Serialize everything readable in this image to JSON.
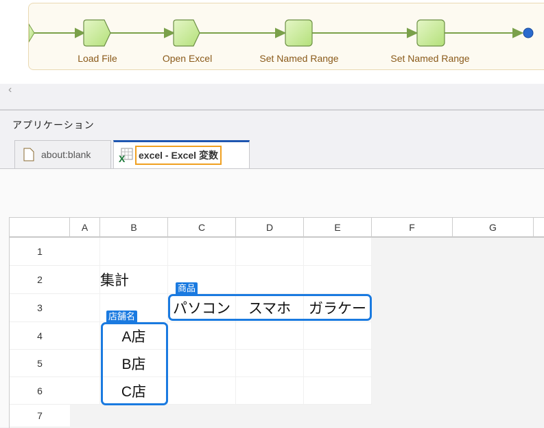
{
  "workflow": {
    "nodes": [
      "Load File",
      "Open Excel",
      "Set Named Range",
      "Set Named Range"
    ]
  },
  "panel": {
    "title": "アプリケーション"
  },
  "tabs": [
    {
      "label": "about:blank"
    },
    {
      "label": "excel - Excel 変数"
    }
  ],
  "sheet": {
    "columns": [
      "A",
      "B",
      "C",
      "D",
      "E",
      "F",
      "G"
    ],
    "rows": [
      "1",
      "2",
      "3",
      "4",
      "5",
      "6",
      "7"
    ],
    "cells": {
      "B2": "集計",
      "C3": "パソコン",
      "D3": "スマホ",
      "E3": "ガラケー",
      "B4": "A店",
      "B5": "B店",
      "B6": "C店"
    },
    "named_ranges": [
      {
        "name": "商品"
      },
      {
        "name": "店舗名"
      }
    ]
  },
  "colors": {
    "accent": "#1a7ae0",
    "tab_active": "#1e56b0",
    "node_fill": "#c8ea96",
    "flow_line": "#7aa04a"
  }
}
